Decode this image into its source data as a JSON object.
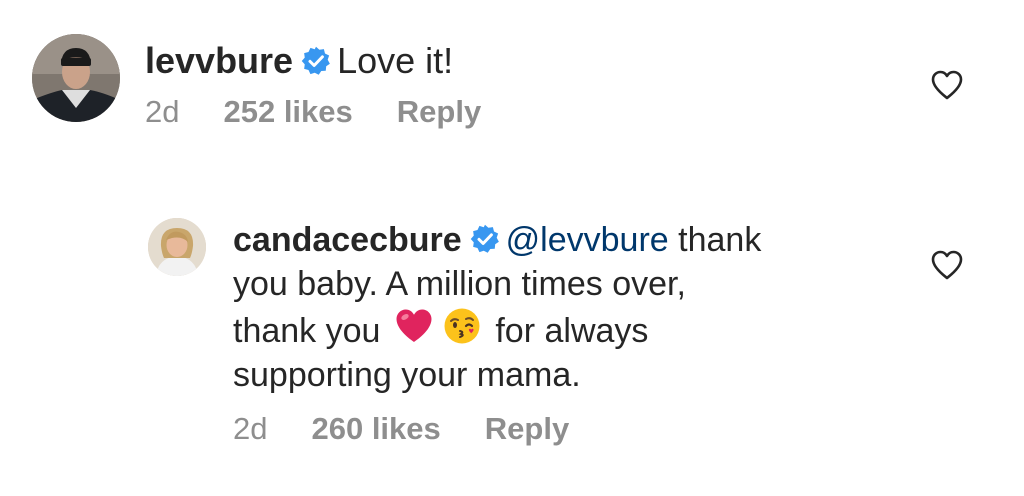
{
  "comments": [
    {
      "username": "levvbure",
      "text": "Love it!",
      "time": "2d",
      "likes": "252 likes",
      "reply_label": "Reply"
    },
    {
      "username": "candacecbure",
      "mention": "@levvbure",
      "text_line1": " thank",
      "text_line2": "you baby. A million times over,",
      "text_line3_a": "thank you",
      "text_line3_b": "for always",
      "text_line4": "supporting your mama.",
      "emojis": [
        "red-heart",
        "face-blowing-a-kiss"
      ],
      "time": "2d",
      "likes": "260 likes",
      "reply_label": "Reply"
    }
  ],
  "colors": {
    "text": "#262626",
    "secondary": "#8e8e8e",
    "verified": "#3897f0",
    "mention": "#00376b",
    "heart_emoji": "#e0245e"
  }
}
